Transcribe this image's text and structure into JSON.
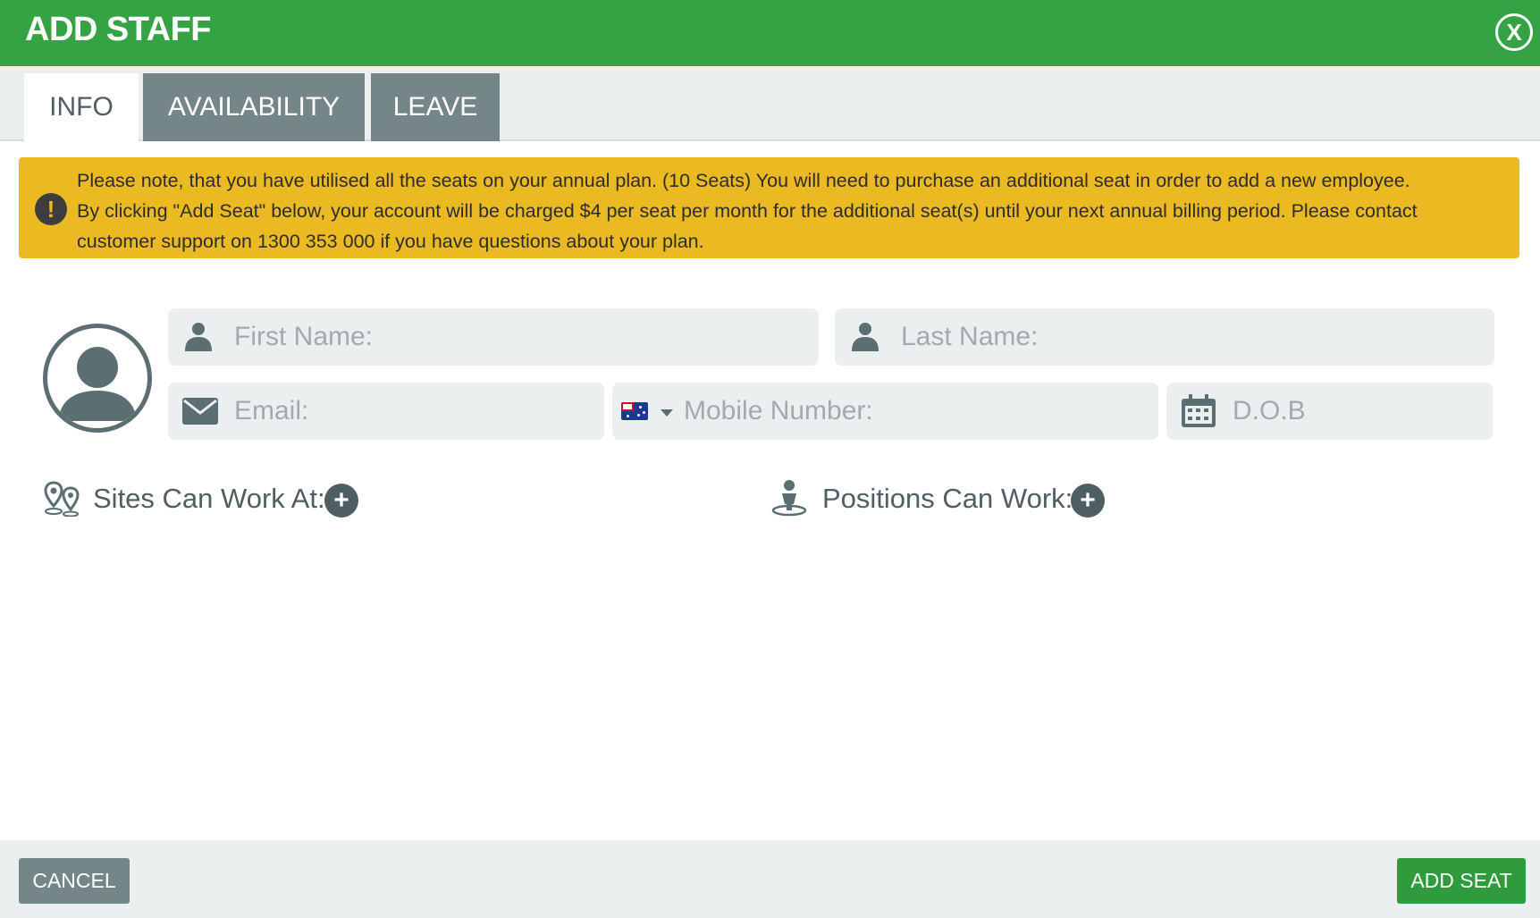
{
  "header": {
    "title": "ADD STAFF",
    "close_label": "X"
  },
  "tabs": [
    {
      "label": "INFO",
      "active": true
    },
    {
      "label": "AVAILABILITY",
      "active": false
    },
    {
      "label": "LEAVE",
      "active": false
    }
  ],
  "notice": {
    "icon": "exclamation-icon",
    "lines": [
      "Please note, that you have utilised all the seats on your annual plan. (10 Seats) You will need to purchase an additional seat in order to add a new employee.",
      "By clicking \"Add Seat\" below, your account will be charged $4 per seat per month for the additional seat(s) until your next annual billing period. Please contact",
      "customer support on 1300 353 000 if you have questions about your plan."
    ]
  },
  "form": {
    "first_name_placeholder": "First Name:",
    "last_name_placeholder": "Last Name:",
    "email_placeholder": "Email:",
    "mobile_placeholder": "Mobile Number:",
    "dob_placeholder": "D.O.B",
    "country_flag": "australia-flag-icon"
  },
  "sections": {
    "sites_label": "Sites Can Work At:",
    "positions_label": "Positions Can Work:",
    "add_symbol": "+"
  },
  "footer": {
    "cancel_label": "CANCEL",
    "add_seat_label": "ADD SEAT"
  },
  "colors": {
    "header_green": "#35a344",
    "tab_inactive": "#758689",
    "notice_yellow": "#ebba22",
    "field_bg": "#eceff0",
    "button_green": "#2f9b3d"
  }
}
